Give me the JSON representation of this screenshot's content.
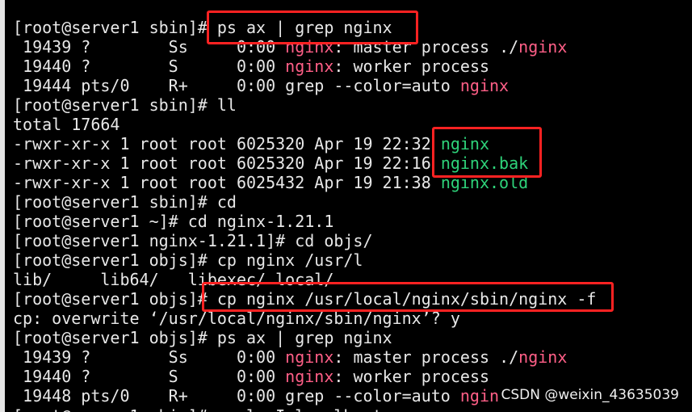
{
  "terminal": {
    "lines": [
      {
        "p": [
          "[root@server1 sbin]# ps ax | grep nginx"
        ]
      },
      {
        "p": [
          " 19439 ?        Ss     0:00 ",
          {
            "t": "nginx",
            "c": "hl"
          },
          ": master process ./",
          {
            "t": "nginx",
            "c": "hl"
          }
        ]
      },
      {
        "p": [
          " 19440 ?        S      0:00 ",
          {
            "t": "nginx",
            "c": "hl"
          },
          ": worker process"
        ]
      },
      {
        "p": [
          " 19444 pts/0    R+     0:00 grep --color=auto ",
          {
            "t": "nginx",
            "c": "hl"
          }
        ]
      },
      {
        "p": [
          "[root@server1 sbin]# ll"
        ]
      },
      {
        "p": [
          "total 17664"
        ]
      },
      {
        "p": [
          "-rwxr-xr-x 1 root root 6025320 Apr 19 22:32 ",
          {
            "t": "nginx",
            "c": "exe"
          }
        ]
      },
      {
        "p": [
          "-rwxr-xr-x 1 root root 6025320 Apr 19 22:16 ",
          {
            "t": "nginx.bak",
            "c": "exe"
          }
        ]
      },
      {
        "p": [
          "-rwxr-xr-x 1 root root 6025432 Apr 19 21:38 ",
          {
            "t": "nginx.old",
            "c": "exe"
          }
        ]
      },
      {
        "p": [
          "[root@server1 sbin]# cd"
        ]
      },
      {
        "p": [
          "[root@server1 ~]# cd nginx-1.21.1"
        ]
      },
      {
        "p": [
          "[root@server1 nginx-1.21.1]# cd objs/"
        ]
      },
      {
        "p": [
          "[root@server1 objs]# cp nginx /usr/l"
        ]
      },
      {
        "p": [
          "lib/     lib64/   libexec/ local/"
        ]
      },
      {
        "p": [
          "[root@server1 objs]# cp nginx /usr/local/nginx/sbin/nginx -f"
        ]
      },
      {
        "p": [
          "cp: overwrite ‘/usr/local/nginx/sbin/nginx’? y"
        ]
      },
      {
        "p": [
          "[root@server1 objs]# ps ax | grep nginx"
        ]
      },
      {
        "p": [
          " 19439 ?        Ss     0:00 ",
          {
            "t": "nginx",
            "c": "hl"
          },
          ": master process ./",
          {
            "t": "nginx",
            "c": "hl"
          }
        ]
      },
      {
        "p": [
          " 19440 ?        S      0:00 ",
          {
            "t": "nginx",
            "c": "hl"
          },
          ": worker process"
        ]
      },
      {
        "p": [
          " 19448 pts/0    R+     0:00 grep --color=auto ",
          {
            "t": "ngin",
            "c": "hl"
          }
        ]
      }
    ]
  },
  "watermark": "CSDN @weixin_43635039",
  "colors": {
    "background": "#000000",
    "text": "#e8e8e8",
    "grep_highlight": "#ff5f87",
    "executable": "#2ed37a",
    "annotation_box": "#ff2222"
  }
}
